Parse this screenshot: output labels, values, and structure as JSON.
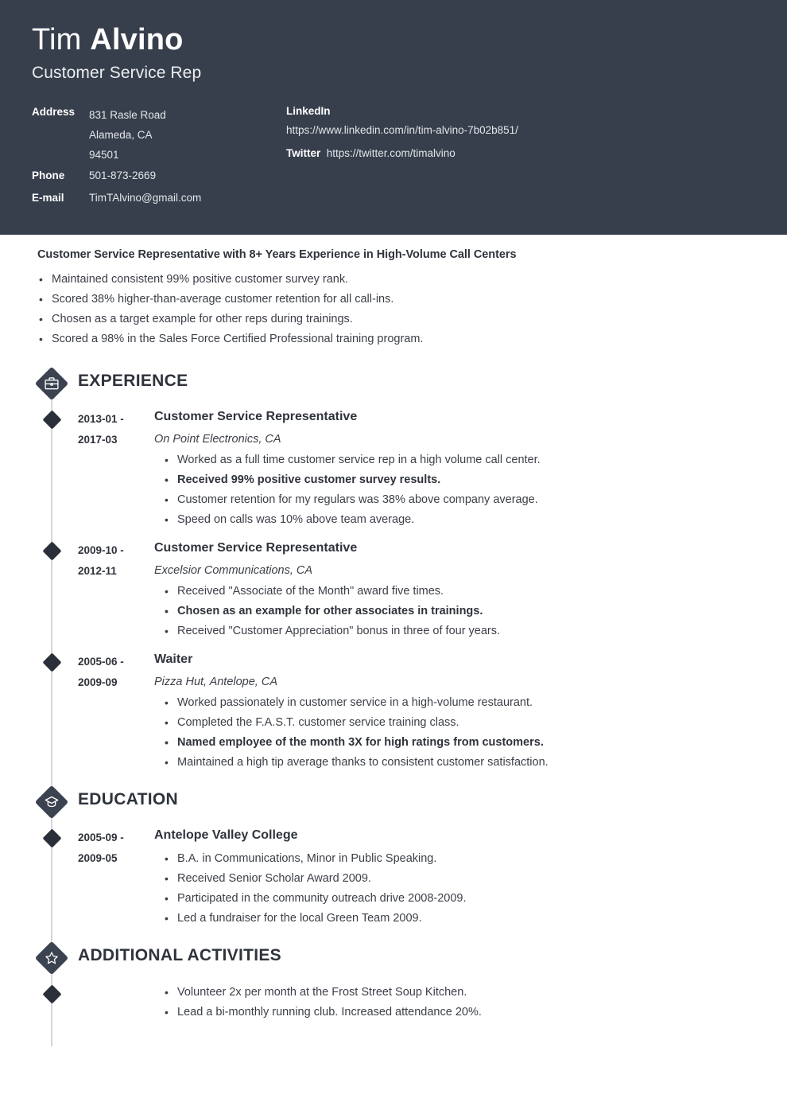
{
  "header": {
    "first_name": "Tim",
    "last_name": "Alvino",
    "job_title": "Customer Service Rep",
    "contact_left": {
      "address_label": "Address",
      "address_lines": [
        "831 Rasle Road",
        "Alameda, CA",
        "94501"
      ],
      "phone_label": "Phone",
      "phone_value": "501-873-2669",
      "email_label": "E-mail",
      "email_value": "TimTAlvino@gmail.com"
    },
    "contact_right": {
      "linkedin_label": "LinkedIn",
      "linkedin_value": "https://www.linkedin.com/in/tim-alvino-7b02b851/",
      "twitter_label": "Twitter",
      "twitter_value": "https://twitter.com/timalvino"
    }
  },
  "summary": {
    "title": "Customer Service Representative with 8+ Years Experience in High-Volume Call Centers",
    "bullets": [
      "Maintained consistent 99% positive customer survey rank.",
      "Scored 38% higher-than-average customer retention for all call-ins.",
      "Chosen as a target example for other reps during trainings.",
      "Scored a 98% in the Sales Force Certified Professional training program."
    ]
  },
  "sections": [
    {
      "name": "EXPERIENCE",
      "icon": "briefcase-icon",
      "entries": [
        {
          "date_start": "2013-01 -",
          "date_end": "2017-03",
          "title": "Customer Service Representative",
          "subtitle": "On Point Electronics, CA",
          "bullets": [
            {
              "text": "Worked as a full time customer service rep in a high volume call center.",
              "bold": false
            },
            {
              "text": "Received 99% positive customer survey results.",
              "bold": true
            },
            {
              "text": "Customer retention for my regulars was 38% above company average.",
              "bold": false
            },
            {
              "text": "Speed on calls was 10% above team average.",
              "bold": false
            }
          ]
        },
        {
          "date_start": "2009-10 -",
          "date_end": "2012-11",
          "title": "Customer Service Representative",
          "subtitle": "Excelsior Communications, CA",
          "bullets": [
            {
              "text": "Received \"Associate of the Month\" award five times.",
              "bold": false
            },
            {
              "text": "Chosen as an example for other associates in trainings.",
              "bold": true
            },
            {
              "text": "Received \"Customer Appreciation\" bonus in three of four years.",
              "bold": false
            }
          ]
        },
        {
          "date_start": "2005-06 -",
          "date_end": "2009-09",
          "title": "Waiter",
          "subtitle": "Pizza Hut, Antelope, CA",
          "bullets": [
            {
              "text": "Worked passionately in customer service in a high-volume restaurant.",
              "bold": false
            },
            {
              "text": "Completed the F.A.S.T. customer service training class.",
              "bold": false
            },
            {
              "text": "Named employee of the month 3X for high ratings from customers.",
              "bold": true
            },
            {
              "text": "Maintained a high tip average thanks to consistent customer satisfaction.",
              "bold": false
            }
          ]
        }
      ]
    },
    {
      "name": "EDUCATION",
      "icon": "graduation-cap-icon",
      "entries": [
        {
          "date_start": "2005-09 -",
          "date_end": "2009-05",
          "title": "Antelope Valley College",
          "subtitle": "",
          "bullets": [
            {
              "text": "B.A. in Communications, Minor in Public Speaking.",
              "bold": false
            },
            {
              "text": "Received Senior Scholar Award 2009.",
              "bold": false
            },
            {
              "text": "Participated in the community outreach drive 2008-2009.",
              "bold": false
            },
            {
              "text": "Led a fundraiser for the local Green Team 2009.",
              "bold": false
            }
          ]
        }
      ]
    },
    {
      "name": "ADDITIONAL ACTIVITIES",
      "icon": "star-icon",
      "entries": [
        {
          "date_start": "",
          "date_end": "",
          "title": "",
          "subtitle": "",
          "bullets": [
            {
              "text": "Volunteer 2x per month at the Frost Street Soup Kitchen.",
              "bold": false
            },
            {
              "text": "Lead a bi-monthly running club. Increased attendance 20%.",
              "bold": false
            }
          ]
        }
      ]
    }
  ],
  "colors": {
    "header_bg": "#373f4c",
    "diamond": "#3b4250",
    "marker": "#2b2f3a",
    "timeline_line": "#d4d6da",
    "text": "#2f333b"
  }
}
